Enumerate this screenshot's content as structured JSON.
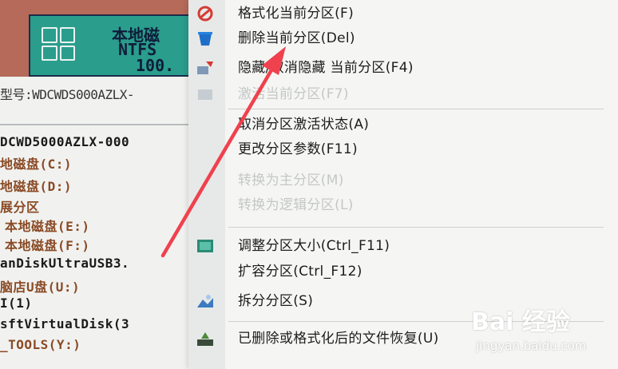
{
  "disk_tile": {
    "line1": "本地磁",
    "line2": "NTFS",
    "line3": "100."
  },
  "model": {
    "label": "型号:",
    "value": "WDCWDS000AZLX-"
  },
  "tree": [
    {
      "text": "DCWD5000AZLX-000",
      "color": "#1a1a1a"
    },
    {
      "text": "地磁盘(C:)",
      "color": "#8a4a25"
    },
    {
      "text": "地磁盘(D:)",
      "color": "#8a4a25"
    },
    {
      "text": "展分区",
      "color": "#8a4a25"
    },
    {
      "text": "本地磁盘(E:)",
      "color": "#8a4a25"
    },
    {
      "text": "本地磁盘(F:)",
      "color": "#8a4a25"
    },
    {
      "text": "anDiskUltraUSB3.",
      "color": "#1a1a1a"
    },
    {
      "text": "脑店U盘(U:)",
      "color": "#8a4a25"
    },
    {
      "text": "I(1)",
      "color": "#1a1a1a"
    },
    {
      "text": "sftVirtualDisk(3",
      "color": "#1a1a1a"
    },
    {
      "text": "_TOOLS(Y:)",
      "color": "#8a4a25"
    }
  ],
  "menu": {
    "items": [
      {
        "label": "格式化当前分区(F)",
        "icon": "format-icon",
        "enabled": true
      },
      {
        "label": "删除当前分区(Del)",
        "icon": "delete-bin-icon",
        "enabled": true
      },
      {
        "label": "隐藏/取消隐藏 当前分区(F4)",
        "icon": "hide-partition-icon",
        "enabled": true
      },
      {
        "label": "激活当前分区(F7)",
        "icon": "activate-icon",
        "enabled": false
      },
      {
        "label": "取消分区激活状态(A)",
        "icon": "",
        "enabled": true
      },
      {
        "label": "更改分区参数(F11)",
        "icon": "",
        "enabled": true
      },
      {
        "label": "转换为主分区(M)",
        "icon": "",
        "enabled": false
      },
      {
        "label": "转换为逻辑分区(L)",
        "icon": "",
        "enabled": false
      },
      {
        "label": "调整分区大小(Ctrl_F11)",
        "icon": "resize-icon",
        "enabled": true
      },
      {
        "label": "扩容分区(Ctrl_F12)",
        "icon": "",
        "enabled": true
      },
      {
        "label": "拆分分区(S)",
        "icon": "split-icon",
        "enabled": true
      },
      {
        "label": "已删除或格式化后的文件恢复(U)",
        "icon": "recover-icon",
        "enabled": true
      }
    ]
  },
  "watermark": {
    "main": "Bai 经验",
    "sub": "jingyan.baidu.com"
  },
  "colors": {
    "arrow": "#f0414e",
    "tile_bg": "#2a9d8d",
    "disabled_text": "#c5c7c6"
  }
}
